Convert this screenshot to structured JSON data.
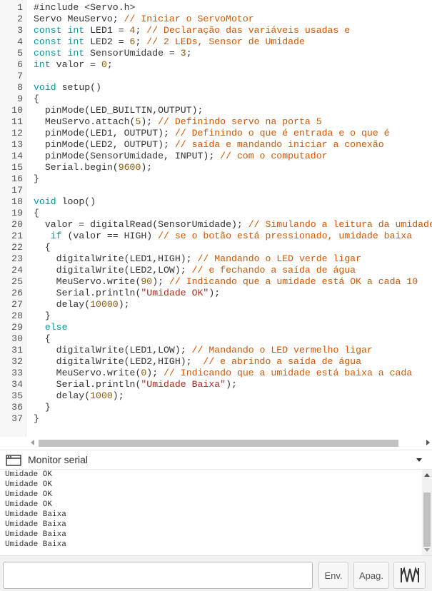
{
  "editor": {
    "lines": [
      [
        {
          "t": "#include <Servo.h>",
          "c": ""
        }
      ],
      [
        {
          "t": "Servo MeuServo; ",
          "c": ""
        },
        {
          "t": "// Iniciar o ServoMotor",
          "c": "cm"
        }
      ],
      [
        {
          "t": "const ",
          "c": "kw"
        },
        {
          "t": "int ",
          "c": "kw"
        },
        {
          "t": "LED1 = ",
          "c": ""
        },
        {
          "t": "4",
          "c": "nu"
        },
        {
          "t": "; ",
          "c": ""
        },
        {
          "t": "// Declaração das variáveis usadas e",
          "c": "cm"
        }
      ],
      [
        {
          "t": "const ",
          "c": "kw"
        },
        {
          "t": "int ",
          "c": "kw"
        },
        {
          "t": "LED2 = ",
          "c": ""
        },
        {
          "t": "6",
          "c": "nu"
        },
        {
          "t": "; ",
          "c": ""
        },
        {
          "t": "// 2 LEDs, Sensor de Umidade",
          "c": "cm"
        }
      ],
      [
        {
          "t": "const ",
          "c": "kw"
        },
        {
          "t": "int ",
          "c": "kw"
        },
        {
          "t": "SensorUmidade = ",
          "c": ""
        },
        {
          "t": "3",
          "c": "nu"
        },
        {
          "t": ";",
          "c": ""
        }
      ],
      [
        {
          "t": "int ",
          "c": "kw"
        },
        {
          "t": "valor = ",
          "c": ""
        },
        {
          "t": "0",
          "c": "nu"
        },
        {
          "t": ";",
          "c": ""
        }
      ],
      [],
      [
        {
          "t": "void ",
          "c": "kw"
        },
        {
          "t": "setup()",
          "c": ""
        }
      ],
      [
        {
          "t": "{",
          "c": ""
        }
      ],
      [
        {
          "t": "  pinMode(LED_BUILTIN,OUTPUT);",
          "c": ""
        }
      ],
      [
        {
          "t": "  MeuServo.attach(",
          "c": ""
        },
        {
          "t": "5",
          "c": "nu"
        },
        {
          "t": "); ",
          "c": ""
        },
        {
          "t": "// Definindo servo na porta 5",
          "c": "cm"
        }
      ],
      [
        {
          "t": "  pinMode(LED1, OUTPUT); ",
          "c": ""
        },
        {
          "t": "// Definindo o que é entrada e o que é",
          "c": "cm"
        }
      ],
      [
        {
          "t": "  pinMode(LED2, OUTPUT); ",
          "c": ""
        },
        {
          "t": "// saída e mandando iniciar a conexão",
          "c": "cm"
        }
      ],
      [
        {
          "t": "  pinMode(SensorUmidade, INPUT); ",
          "c": ""
        },
        {
          "t": "// com o computador",
          "c": "cm"
        }
      ],
      [
        {
          "t": "  Serial.begin(",
          "c": ""
        },
        {
          "t": "9600",
          "c": "nu"
        },
        {
          "t": ");",
          "c": ""
        }
      ],
      [
        {
          "t": "}",
          "c": ""
        }
      ],
      [],
      [
        {
          "t": "void ",
          "c": "kw"
        },
        {
          "t": "loop()",
          "c": ""
        }
      ],
      [
        {
          "t": "{",
          "c": ""
        }
      ],
      [
        {
          "t": "  valor = digitalRead(SensorUmidade); ",
          "c": ""
        },
        {
          "t": "// Simulando a leitura da umidade",
          "c": "cm"
        }
      ],
      [
        {
          "t": "   ",
          "c": ""
        },
        {
          "t": "if ",
          "c": "kw"
        },
        {
          "t": "(valor == HIGH) ",
          "c": ""
        },
        {
          "t": "// se o botão está pressionado, umidade baixa",
          "c": "cm"
        }
      ],
      [
        {
          "t": "  {",
          "c": ""
        }
      ],
      [
        {
          "t": "    digitalWrite(LED1,HIGH); ",
          "c": ""
        },
        {
          "t": "// Mandando o LED verde ligar",
          "c": "cm"
        }
      ],
      [
        {
          "t": "    digitalWrite(LED2,LOW); ",
          "c": ""
        },
        {
          "t": "// e fechando a saída de água",
          "c": "cm"
        }
      ],
      [
        {
          "t": "    MeuServo.write(",
          "c": ""
        },
        {
          "t": "90",
          "c": "nu"
        },
        {
          "t": "); ",
          "c": ""
        },
        {
          "t": "// Indicando que a umidade está OK a cada 10",
          "c": "cm"
        }
      ],
      [
        {
          "t": "    Serial.println(",
          "c": ""
        },
        {
          "t": "\"Umidade OK\"",
          "c": "st"
        },
        {
          "t": ");",
          "c": ""
        }
      ],
      [
        {
          "t": "    delay(",
          "c": ""
        },
        {
          "t": "10000",
          "c": "nu"
        },
        {
          "t": ");",
          "c": ""
        }
      ],
      [
        {
          "t": "  }",
          "c": ""
        }
      ],
      [
        {
          "t": "  ",
          "c": ""
        },
        {
          "t": "else",
          "c": "kw"
        }
      ],
      [
        {
          "t": "  {",
          "c": ""
        }
      ],
      [
        {
          "t": "    digitalWrite(LED1,LOW); ",
          "c": ""
        },
        {
          "t": "// Mandando o LED vermelho ligar",
          "c": "cm"
        }
      ],
      [
        {
          "t": "    digitalWrite(LED2,HIGH);  ",
          "c": ""
        },
        {
          "t": "// e abrindo a saída de água",
          "c": "cm"
        }
      ],
      [
        {
          "t": "    MeuServo.write(",
          "c": ""
        },
        {
          "t": "0",
          "c": "nu"
        },
        {
          "t": "); ",
          "c": ""
        },
        {
          "t": "// Indicando que a umidade está baixa a cada",
          "c": "cm"
        }
      ],
      [
        {
          "t": "    Serial.println(",
          "c": ""
        },
        {
          "t": "\"Umidade Baixa\"",
          "c": "st"
        },
        {
          "t": ");",
          "c": ""
        }
      ],
      [
        {
          "t": "    delay(",
          "c": ""
        },
        {
          "t": "1000",
          "c": "nu"
        },
        {
          "t": ");",
          "c": ""
        }
      ],
      [
        {
          "t": "  }",
          "c": ""
        }
      ],
      [
        {
          "t": "}",
          "c": ""
        }
      ]
    ]
  },
  "monitor": {
    "title": "Monitor serial",
    "output_lines": [
      "Umidade OK",
      "Umidade OK",
      "Umidade OK",
      "Umidade OK",
      "Umidade Baixa",
      "Umidade Baixa",
      "Umidade Baixa",
      "Umidade Baixa"
    ],
    "input_value": "",
    "send_label": "Env.",
    "clear_label": "Apag."
  },
  "icons": {
    "monitor": "serial-monitor-window-icon",
    "collapse": "chevron-down-icon",
    "plotter": "waveform-plotter-icon"
  },
  "colors": {
    "keyword": "#00979c",
    "comment": "#d35400",
    "number": "#8a5a00",
    "string": "#a32f1e"
  }
}
